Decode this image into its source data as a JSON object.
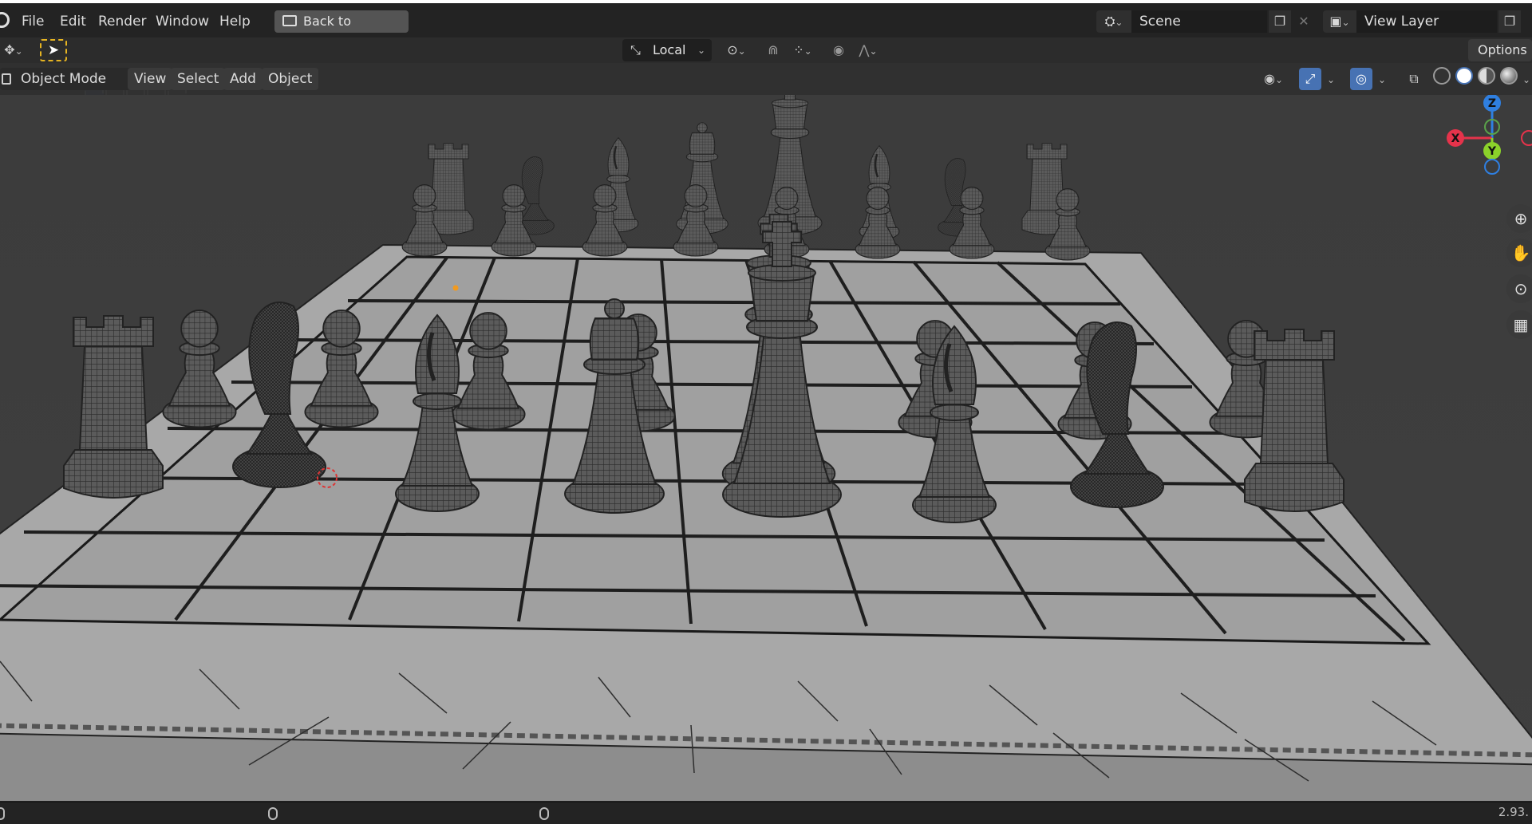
{
  "menus": {
    "file": "File",
    "edit": "Edit",
    "render": "Render",
    "window": "Window",
    "help": "Help"
  },
  "back_button": {
    "label": "Back to Previous"
  },
  "scene": {
    "value": "Scene"
  },
  "view_layer": {
    "value": "View Layer"
  },
  "toolbar": {
    "transform_orientation": "Local",
    "options_label": "Options"
  },
  "header": {
    "mode": "Object Mode",
    "view": "View",
    "select": "Select",
    "add": "Add",
    "object": "Object"
  },
  "gizmo": {
    "z": "Z",
    "x": "X",
    "y": "Y"
  },
  "status": {
    "version": "2.93."
  },
  "icons": {
    "app": "blender-logo-icon",
    "back": "back-window-icon",
    "scene": "scene-icon",
    "view_layer": "view-layer-icon",
    "snap": "magnet-icon",
    "zoom": "zoom-icon",
    "pan": "hand-icon",
    "camera": "camera-icon",
    "ortho": "grid-icon"
  },
  "colors": {
    "accent": "#4772b3",
    "select_box": "#e6b422",
    "axis_x": "#e5334b",
    "axis_y": "#8bd22a",
    "axis_z": "#2f7fe0"
  }
}
